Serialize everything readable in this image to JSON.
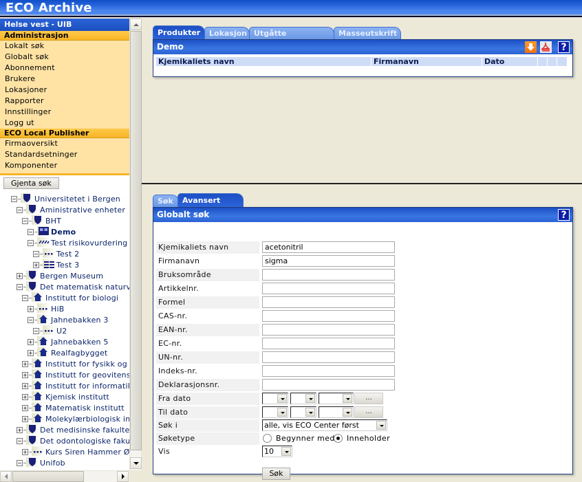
{
  "app": {
    "title": "ECO Archive"
  },
  "sidebar": {
    "header": "Helse vest - UIB",
    "sections": [
      {
        "title": "Administrasjon",
        "items": [
          "Lokalt søk",
          "Globalt søk",
          "Abonnement",
          "Brukere",
          "Lokasjoner",
          "Rapporter",
          "Innstillinger",
          "Logg ut"
        ]
      },
      {
        "title": "ECO Local Publisher",
        "items": [
          "Firmaoversikt",
          "Standardsetninger",
          "Komponenter"
        ]
      }
    ],
    "redo_button": "Gjenta søk",
    "tree": [
      {
        "label": "Universitetet i Bergen",
        "level": 0,
        "toggle": "minus",
        "icon": "shield"
      },
      {
        "label": "Aministrative enheter",
        "level": 1,
        "toggle": "minus",
        "icon": "shield"
      },
      {
        "label": "BHT",
        "level": 2,
        "toggle": "minus",
        "icon": "shield"
      },
      {
        "label": "Demo",
        "level": 3,
        "toggle": "minus",
        "icon": "double-square",
        "bold": true
      },
      {
        "label": "Test risikovurdering",
        "level": 3,
        "toggle": "minus",
        "icon": "hatch"
      },
      {
        "label": "Test 2",
        "level": 4,
        "toggle": "minus",
        "icon": "dots"
      },
      {
        "label": "Test 3",
        "level": 4,
        "toggle": "plus",
        "icon": "lines"
      },
      {
        "label": "Bergen Museum",
        "level": 1,
        "toggle": "plus",
        "icon": "shield"
      },
      {
        "label": "Det matematisk naturvi",
        "level": 1,
        "toggle": "minus",
        "icon": "shield"
      },
      {
        "label": "Institutt for biologi",
        "level": 2,
        "toggle": "minus",
        "icon": "house"
      },
      {
        "label": "HiB",
        "level": 3,
        "toggle": "plus",
        "icon": "dots"
      },
      {
        "label": "Jahnebakken 3",
        "level": 3,
        "toggle": "minus",
        "icon": "house"
      },
      {
        "label": "U2",
        "level": 4,
        "toggle": "minus",
        "icon": "dots"
      },
      {
        "label": "Jahnebakken 5",
        "level": 3,
        "toggle": "plus",
        "icon": "house"
      },
      {
        "label": "Realfagbygget",
        "level": 3,
        "toggle": "plus",
        "icon": "house"
      },
      {
        "label": "Institutt for fysikk og t",
        "level": 2,
        "toggle": "plus",
        "icon": "house"
      },
      {
        "label": "Institutt for geovitensl",
        "level": 2,
        "toggle": "plus",
        "icon": "house"
      },
      {
        "label": "Institutt for informatik",
        "level": 2,
        "toggle": "plus",
        "icon": "house"
      },
      {
        "label": "Kjemisk institutt",
        "level": 2,
        "toggle": "plus",
        "icon": "house"
      },
      {
        "label": "Matematisk institutt",
        "level": 2,
        "toggle": "plus",
        "icon": "house"
      },
      {
        "label": "Molekylærbiologisk ins",
        "level": 2,
        "toggle": "plus",
        "icon": "house"
      },
      {
        "label": "Det medisinske fakulte",
        "level": 1,
        "toggle": "plus",
        "icon": "shield"
      },
      {
        "label": "Det odontologiske faku",
        "level": 1,
        "toggle": "minus",
        "icon": "shield"
      },
      {
        "label": "Kurs Siren Hammer Ø:",
        "level": 2,
        "toggle": "plus",
        "icon": "dots"
      },
      {
        "label": "Unifob",
        "level": 1,
        "toggle": "minus",
        "icon": "shield"
      }
    ]
  },
  "products_panel": {
    "tabs": [
      "Produkter",
      "Lokasjon",
      "Utgåtte produkter",
      "Masseutskrift"
    ],
    "active_tab": 0,
    "title": "Demo",
    "columns": [
      "Kjemikaliets navn",
      "Firmanavn",
      "Dato"
    ],
    "icons": [
      "download-icon",
      "pdf-icon",
      "help-icon"
    ],
    "help_label": "?"
  },
  "search_panel": {
    "tabs": [
      "Søk",
      "Avansert søk"
    ],
    "active_tab": 1,
    "title": "Globalt søk",
    "help_label": "?",
    "fields": [
      {
        "label": "Kjemikaliets navn",
        "value": "acetonitril"
      },
      {
        "label": "Firmanavn",
        "value": "sigma"
      },
      {
        "label": "Bruksområde",
        "value": ""
      },
      {
        "label": "Artikkelnr.",
        "value": ""
      },
      {
        "label": "Formel",
        "value": ""
      },
      {
        "label": "CAS-nr.",
        "value": ""
      },
      {
        "label": "EAN-nr.",
        "value": ""
      },
      {
        "label": "EC-nr.",
        "value": ""
      },
      {
        "label": "UN-nr.",
        "value": ""
      },
      {
        "label": "Indeks-nr.",
        "value": ""
      },
      {
        "label": "Deklarasjonsnr.",
        "value": ""
      }
    ],
    "from_date_label": "Fra dato",
    "to_date_label": "Til dato",
    "date_button": "...",
    "search_in_label": "Søk i",
    "search_in_value": "alle, vis ECO Center først",
    "search_type_label": "Søketype",
    "search_type_options": [
      "Begynner med",
      "Inneholder"
    ],
    "search_type_selected": "Inneholder",
    "show_label": "Vis",
    "show_value": "10",
    "submit_label": "Søk"
  }
}
